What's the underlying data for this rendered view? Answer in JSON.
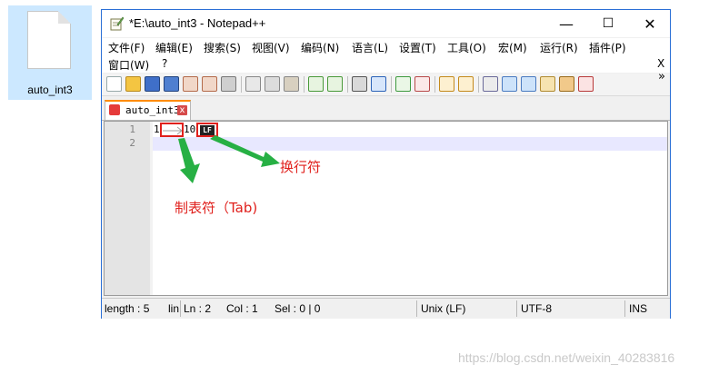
{
  "desktop": {
    "file_label": "auto_int3"
  },
  "window": {
    "title": "*E:\\auto_int3 - Notepad++",
    "controls": {
      "minimize": "—",
      "maximize": "☐",
      "close": "✕"
    }
  },
  "menu": {
    "items": [
      "文件(F)",
      "编辑(E)",
      "搜索(S)",
      "视图(V)",
      "编码(N)",
      "语言(L)",
      "设置(T)",
      "工具(O)",
      "宏(M)",
      "运行(R)",
      "插件(P)",
      "窗口(W)",
      "?"
    ],
    "close_doc": "X"
  },
  "toolbar": {
    "overflow": "»"
  },
  "tab": {
    "label": "auto_int3",
    "close": "x"
  },
  "editor": {
    "line_numbers": [
      "1",
      "2"
    ],
    "line1_char": "1",
    "line1_value": "10",
    "lf_symbol": "LF"
  },
  "annotations": {
    "newline": "换行符",
    "tab": "制表符（Tab)"
  },
  "status": {
    "length": "length : 5",
    "lin": "lin",
    "ln": "Ln : 2",
    "col": "Col : 1",
    "sel": "Sel : 0 | 0",
    "eol": "Unix (LF)",
    "encoding": "UTF-8",
    "mode": "INS"
  },
  "watermark": "https://blog.csdn.net/weixin_40283816",
  "colors": {
    "annotation": "#e0201c",
    "arrow": "#27b044",
    "window_border": "#2a6fd6"
  }
}
